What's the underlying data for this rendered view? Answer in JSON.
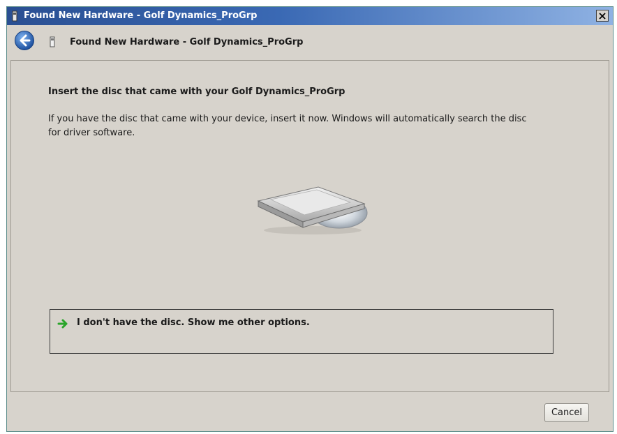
{
  "window": {
    "title": "Found New Hardware - Golf Dynamics_ProGrp",
    "close_label": "X",
    "colors": {
      "titlebar": "#2a4f92",
      "body": "#d7d3cc"
    }
  },
  "nav": {
    "title": "Found New Hardware - Golf Dynamics_ProGrp",
    "back_icon": "back-arrow-icon",
    "device_icon": "usb-device-icon"
  },
  "main": {
    "heading": "Insert the disc that came with your Golf Dynamics_ProGrp",
    "description": "If you have the disc that came with your device, insert it now.  Windows will automatically search the disc for driver software.",
    "image_icon": "disc-drive-icon",
    "option": {
      "icon": "green-arrow-icon",
      "label": "I don't have the disc.  Show me other options."
    }
  },
  "footer": {
    "cancel_label": "Cancel"
  }
}
